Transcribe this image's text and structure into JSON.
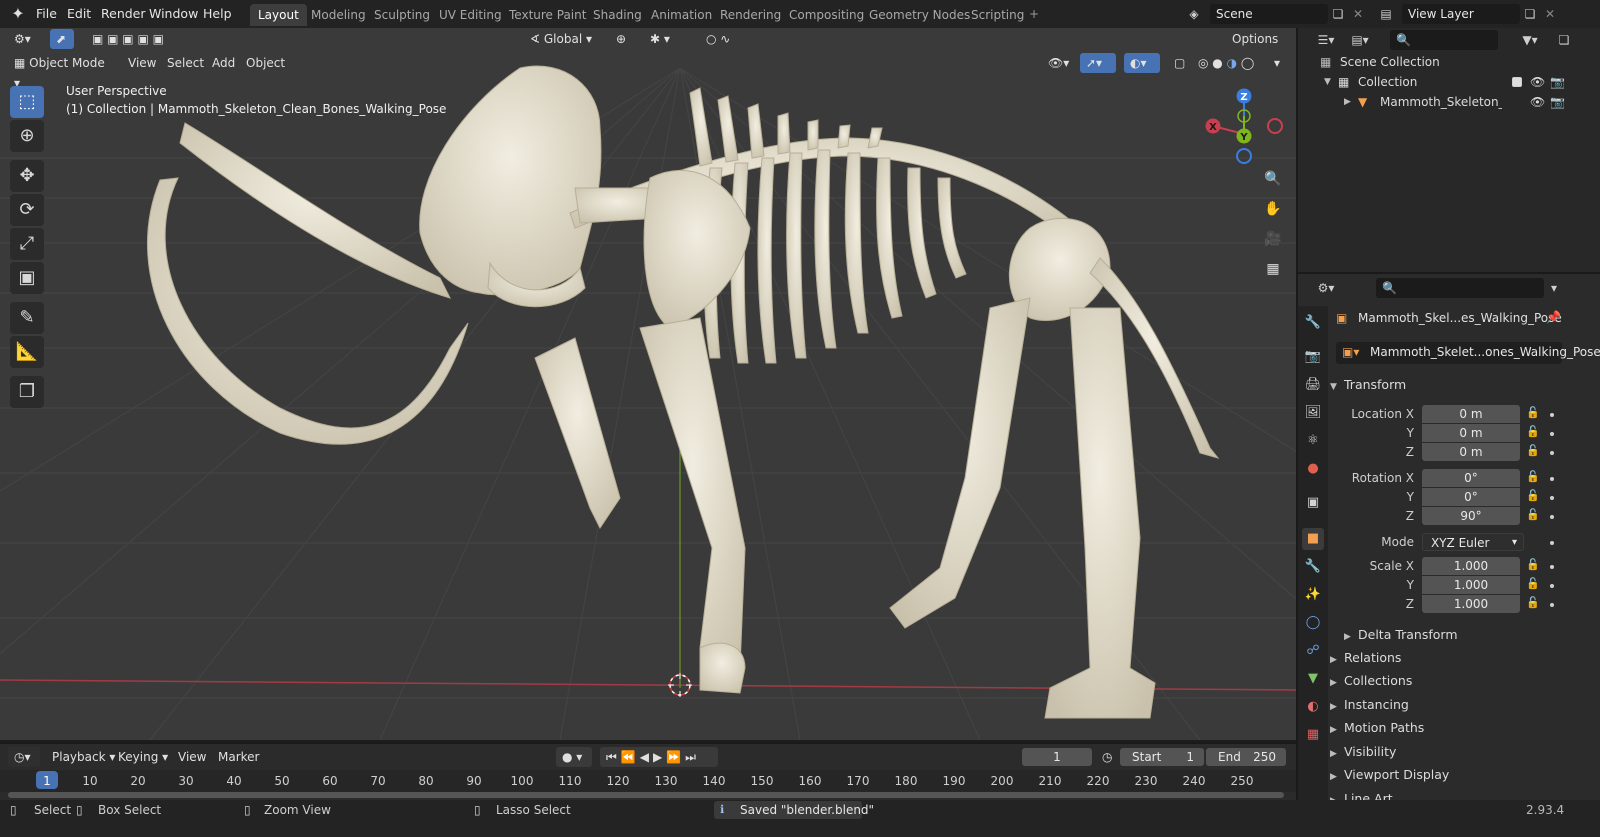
{
  "topbar": {
    "menus": [
      "File",
      "Edit",
      "Render",
      "Window",
      "Help"
    ],
    "workspaces": [
      "Layout",
      "Modeling",
      "Sculpting",
      "UV Editing",
      "Texture Paint",
      "Shading",
      "Animation",
      "Rendering",
      "Compositing",
      "Geometry Nodes",
      "Scripting"
    ],
    "active_workspace": "Layout",
    "scene": "Scene",
    "view_layer": "View Layer"
  },
  "viewport": {
    "mode": "Object Mode",
    "menus": [
      "View",
      "Select",
      "Add",
      "Object"
    ],
    "orientation": "Global",
    "options": "Options",
    "info_line1": "User Perspective",
    "info_line2": "(1) Collection | Mammoth_Skeleton_Clean_Bones_Walking_Pose"
  },
  "gizmo": {
    "z": "Z",
    "y": "Y",
    "x": "X"
  },
  "outliner": {
    "scene_collection": "Scene Collection",
    "collection": "Collection",
    "object": "Mammoth_Skeleton_Clea"
  },
  "properties": {
    "object_name": "Mammoth_Skel...es_Walking_Pose",
    "data_name": "Mammoth_Skelet...ones_Walking_Pose",
    "transform_title": "Transform",
    "location_label": "Location X",
    "location": [
      "0 m",
      "0 m",
      "0 m"
    ],
    "rotation_label": "Rotation X",
    "rotation": [
      "0°",
      "0°",
      "90°"
    ],
    "mode_label": "Mode",
    "mode_value": "XYZ Euler",
    "scale_label": "Scale X",
    "scale": [
      "1.000",
      "1.000",
      "1.000"
    ],
    "y_label": "Y",
    "z_label": "Z",
    "delta_transform": "Delta Transform",
    "panels": [
      "Relations",
      "Collections",
      "Instancing",
      "Motion Paths",
      "Visibility",
      "Viewport Display",
      "Line Art"
    ]
  },
  "timeline": {
    "menus": [
      "Playback",
      "Keying",
      "View",
      "Marker"
    ],
    "current_frame": "1",
    "start_label": "Start",
    "start": "1",
    "end_label": "End",
    "end": "250",
    "ruler": [
      "1",
      "10",
      "20",
      "30",
      "40",
      "50",
      "60",
      "70",
      "80",
      "90",
      "100",
      "110",
      "120",
      "130",
      "140",
      "150",
      "160",
      "170",
      "180",
      "190",
      "200",
      "210",
      "220",
      "230",
      "240",
      "250"
    ]
  },
  "status": {
    "select": "Select",
    "box_select": "Box Select",
    "zoom_view": "Zoom View",
    "lasso_select": "Lasso Select",
    "message": "Saved \"blender.blend\"",
    "version": "2.93.4"
  },
  "colors": {
    "accent": "#4772b3",
    "axis_x": "#c8404f",
    "axis_y": "#7fb51d",
    "axis_z": "#3a7ee0",
    "bone": "#e9e4d4"
  }
}
